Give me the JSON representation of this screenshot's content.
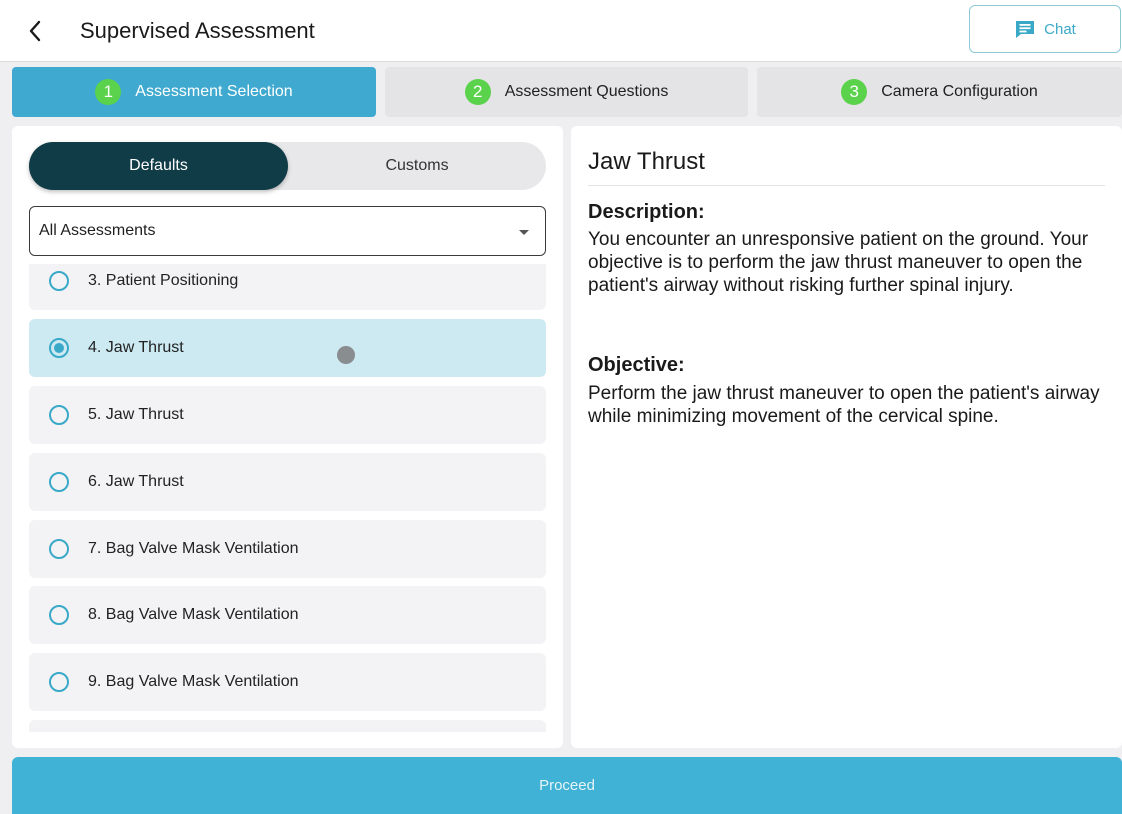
{
  "header": {
    "title": "Supervised Assessment",
    "back_icon": "chevron-left-icon",
    "chat": {
      "label": "Chat",
      "icon": "chat-bubble-icon"
    }
  },
  "steps": [
    {
      "number": "1",
      "label": "Assessment Selection",
      "active": true
    },
    {
      "number": "2",
      "label": "Assessment Questions",
      "active": false
    },
    {
      "number": "3",
      "label": "Camera Configuration",
      "active": false
    }
  ],
  "selection": {
    "segments": {
      "defaults": "Defaults",
      "customs": "Customs",
      "active": "Defaults"
    },
    "filter": {
      "value": "All Assessments"
    },
    "items": [
      {
        "label": "3. Patient Positioning",
        "selected": false
      },
      {
        "label": "4. Jaw Thrust",
        "selected": true
      },
      {
        "label": "5. Jaw Thrust",
        "selected": false
      },
      {
        "label": "6. Jaw Thrust",
        "selected": false
      },
      {
        "label": "7. Bag Valve Mask Ventilation",
        "selected": false
      },
      {
        "label": "8. Bag Valve Mask Ventilation",
        "selected": false
      },
      {
        "label": "9. Bag Valve Mask Ventilation",
        "selected": false
      }
    ]
  },
  "detail": {
    "title": "Jaw Thrust",
    "description_heading": "Description:",
    "description": "You encounter an unresponsive patient on the ground. Your objective is to perform the jaw thrust maneuver to open the patient's airway without risking further spinal injury.",
    "objective_heading": "Objective:",
    "objective": "Perform the jaw thrust maneuver to open the patient's airway while minimizing movement of the cervical spine."
  },
  "footer": {
    "proceed_label": "Proceed"
  },
  "colors": {
    "accent": "#3fa9cf",
    "step_badge": "#5ad24b",
    "segment_active": "#0f3c47",
    "selected_row": "#cdeaf2",
    "proceed": "#3fb2d6"
  }
}
